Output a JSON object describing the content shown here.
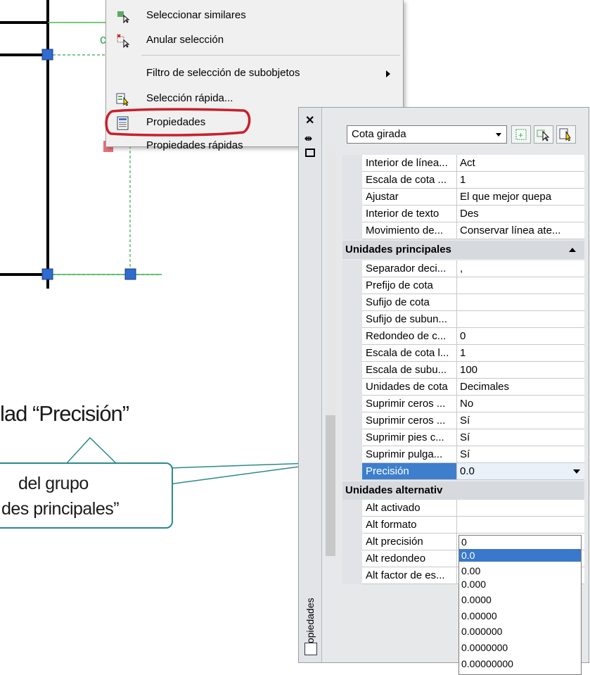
{
  "context_menu": {
    "items": [
      {
        "label": "Seleccionar similares",
        "icon": "select-similar-icon"
      },
      {
        "label": "Anular selección",
        "icon": "deselect-icon"
      },
      {
        "label": "Filtro de selección de subobjetos",
        "icon": "",
        "submenu": true
      },
      {
        "label": "Selección rápida...",
        "icon": "quick-select-icon"
      },
      {
        "label": "Propiedades",
        "icon": "properties-icon"
      },
      {
        "label": "Propiedades rápidas",
        "icon": ""
      }
    ]
  },
  "callout": {
    "top_text": "lad “Precisión”",
    "box_line1": "del grupo",
    "box_line2": "des principales”",
    "color": "#2b8a8a"
  },
  "palette": {
    "vertical_title": "Propiedades",
    "object_type": "Cota girada",
    "rows_top": [
      {
        "k": "Interior de línea...",
        "v": "Act"
      },
      {
        "k": "Escala de cota ...",
        "v": "1"
      },
      {
        "k": "Ajustar",
        "v": "El que mejor quepa"
      },
      {
        "k": "Interior de texto",
        "v": "Des"
      },
      {
        "k": "Movimiento de...",
        "v": "Conservar línea ate..."
      }
    ],
    "group_primary": "Unidades principales",
    "rows_primary": [
      {
        "k": "Separador deci...",
        "v": ","
      },
      {
        "k": "Prefijo de cota",
        "v": ""
      },
      {
        "k": "Sufijo de cota",
        "v": ""
      },
      {
        "k": "Sufijo de subun...",
        "v": ""
      },
      {
        "k": "Redondeo de c...",
        "v": "0"
      },
      {
        "k": "Escala de cota l...",
        "v": "1"
      },
      {
        "k": "Escala de subu...",
        "v": "100"
      },
      {
        "k": "Unidades de cota",
        "v": "Decimales"
      },
      {
        "k": "Suprimir ceros ...",
        "v": "No"
      },
      {
        "k": "Suprimir ceros ...",
        "v": "Sí"
      },
      {
        "k": "Suprimir pies c...",
        "v": "Sí"
      },
      {
        "k": "Suprimir pulga...",
        "v": "Sí"
      },
      {
        "k": "Precisión",
        "v": "0.0"
      }
    ],
    "group_alt": "Unidades alternativ",
    "rows_alt": [
      {
        "k": "Alt activado"
      },
      {
        "k": "Alt formato"
      },
      {
        "k": "Alt precisión"
      },
      {
        "k": "Alt redondeo"
      },
      {
        "k": "Alt factor de es..."
      }
    ],
    "precision_options": [
      "0",
      "0.0",
      "0.00",
      "0.000",
      "0.0000",
      "0.00000",
      "0.000000",
      "0.0000000",
      "0.00000000"
    ],
    "precision_selected": "0.0",
    "accent": "#3d7fcc"
  }
}
